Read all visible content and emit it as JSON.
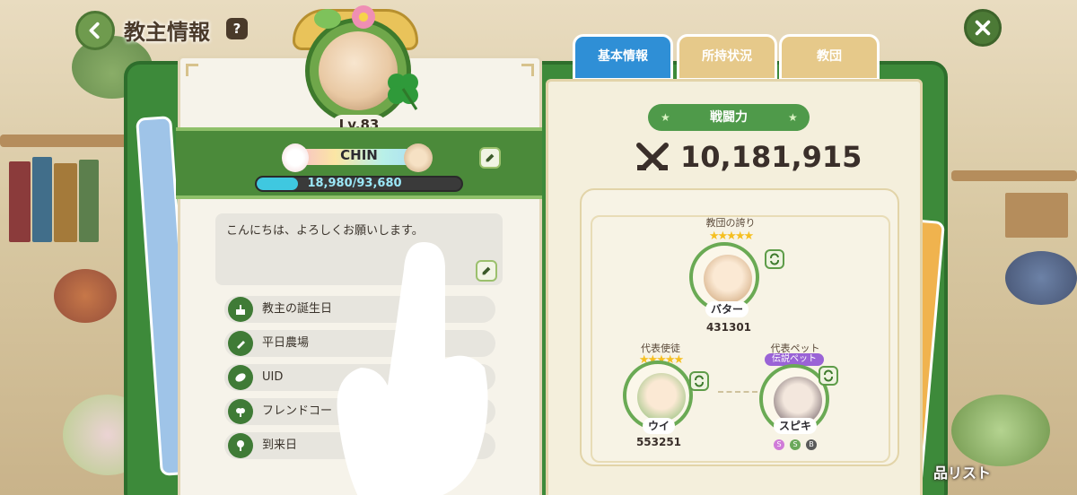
{
  "header": {
    "title": "教主情報",
    "help": "?"
  },
  "tabs": [
    {
      "label": "基本情報",
      "active": true
    },
    {
      "label": "所持状況",
      "active": false
    },
    {
      "label": "教団",
      "active": false
    }
  ],
  "profile": {
    "level": "Lv.83",
    "name": "CHIN",
    "exp_text": "18,980/93,680",
    "exp_fraction": 0.2026,
    "greeting": "こんにちは、よろしくお願いします。"
  },
  "info_rows": [
    {
      "label": "教主の誕生日",
      "icon": "cake-icon"
    },
    {
      "label": "平日農場",
      "icon": "carrot-icon"
    },
    {
      "label": "UID",
      "icon": "leaf-icon"
    },
    {
      "label": "フレンドコー",
      "icon": "sprout-icon"
    },
    {
      "label": "到来日",
      "icon": "bud-icon"
    }
  ],
  "power": {
    "label": "戦闘力",
    "value": "10,181,915"
  },
  "team": {
    "pride": {
      "label": "教団の誇り",
      "name": "バター",
      "power": "431301",
      "stars": "★★★★★"
    },
    "rep_disciple": {
      "label": "代表使徒",
      "name": "ウイ",
      "power": "553251",
      "stars": "★★★★★"
    },
    "rep_pet": {
      "label": "代表ペット",
      "tag": "伝説ペット",
      "name": "スピキ",
      "skills": [
        "S",
        "S",
        "B"
      ]
    }
  },
  "bottom_right": "品リスト",
  "colors": {
    "accent_green": "#4f9a4a",
    "tab_active": "#2f8fd6",
    "tab_inactive": "#e6c98a",
    "exp_fill": "#3fc8e0"
  }
}
